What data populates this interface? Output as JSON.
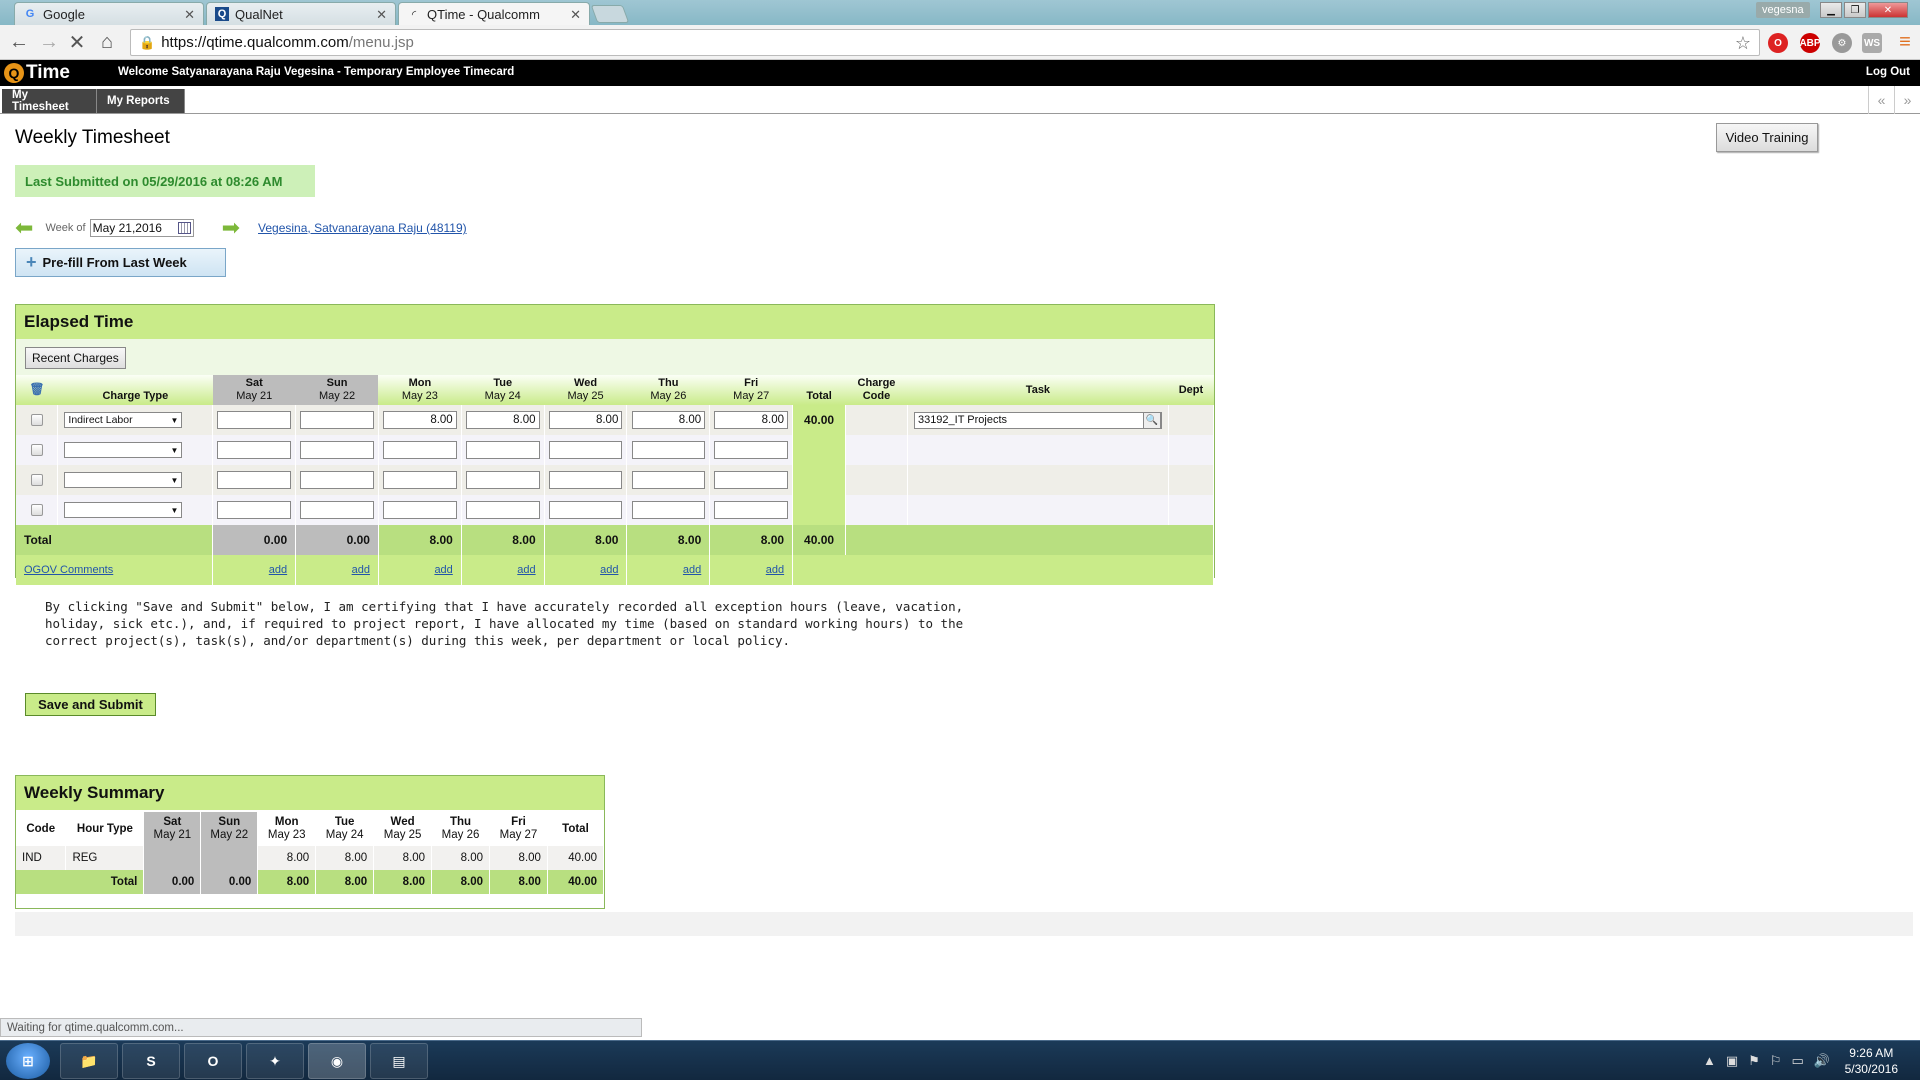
{
  "browser": {
    "tabs": [
      {
        "label": "Google",
        "icon": "G"
      },
      {
        "label": "QualNet",
        "icon": "Q"
      },
      {
        "label": "QTime - Qualcomm",
        "icon": ""
      }
    ],
    "window_user": "vegesna",
    "url_host": "https://qtime.qualcomm.com",
    "url_path": "/menu.jsp",
    "extensions": [
      {
        "name": "opera-icon",
        "color": "#d22"
      },
      {
        "name": "adblock-icon",
        "label": "ABP",
        "color": "#c00"
      },
      {
        "name": "extension-icon",
        "color": "#999"
      },
      {
        "name": "ws-icon",
        "label": "WS",
        "color": "#aaa"
      }
    ]
  },
  "app": {
    "logo_text": "Time",
    "welcome": "Welcome Satyanarayana Raju Vegesina - Temporary Employee Timecard",
    "logout": "Log Out",
    "nav": [
      "My Timesheet",
      "My Reports"
    ]
  },
  "page": {
    "title": "Weekly Timesheet",
    "video_training": "Video Training",
    "last_submitted": "Last Submitted on 05/29/2016 at 08:26 AM",
    "week_of_label": "Week of",
    "week_of_value": "May 21,2016",
    "employee_link": "Vegesina, Satvanarayana Raju (48119)",
    "prefill_label": "Pre-fill From Last Week"
  },
  "elapsed": {
    "title": "Elapsed Time",
    "recent_charges": "Recent Charges",
    "headers": {
      "charge_type": "Charge Type",
      "days": [
        {
          "day": "Sat",
          "date": "May 21"
        },
        {
          "day": "Sun",
          "date": "May 22"
        },
        {
          "day": "Mon",
          "date": "May 23"
        },
        {
          "day": "Tue",
          "date": "May 24"
        },
        {
          "day": "Wed",
          "date": "May 25"
        },
        {
          "day": "Thu",
          "date": "May 26"
        },
        {
          "day": "Fri",
          "date": "May 27"
        }
      ],
      "total": "Total",
      "charge_code": "Charge Code",
      "charge_code_line1": "Charge",
      "charge_code_line2": "Code",
      "task": "Task",
      "dept": "Dept"
    },
    "rows": [
      {
        "charge_type": "Indirect Labor",
        "hours": [
          "",
          "",
          "8.00",
          "8.00",
          "8.00",
          "8.00",
          "8.00"
        ],
        "total": "40.00",
        "task": "33192_IT Projects"
      },
      {
        "charge_type": "",
        "hours": [
          "",
          "",
          "",
          "",
          "",
          "",
          ""
        ],
        "total": "",
        "task": ""
      },
      {
        "charge_type": "",
        "hours": [
          "",
          "",
          "",
          "",
          "",
          "",
          ""
        ],
        "total": "",
        "task": ""
      },
      {
        "charge_type": "",
        "hours": [
          "",
          "",
          "",
          "",
          "",
          "",
          ""
        ],
        "total": "",
        "task": ""
      }
    ],
    "total_label": "Total",
    "day_totals": [
      "0.00",
      "0.00",
      "8.00",
      "8.00",
      "8.00",
      "8.00",
      "8.00"
    ],
    "grand_total": "40.00",
    "comments_link": "OGOV Comments",
    "add_label": "add"
  },
  "certify_text": "By clicking \"Save and Submit\" below, I am certifying that I have accurately recorded all exception hours (leave, vacation, holiday, sick etc.), and, if required to project report, I have allocated my time (based on standard working hours) to the correct project(s), task(s), and/or department(s) during this week, per department or local policy.",
  "save_submit": "Save and Submit",
  "summary": {
    "title": "Weekly Summary",
    "headers": {
      "code": "Code",
      "hour_type": "Hour Type",
      "total": "Total"
    },
    "row": {
      "code": "IND",
      "hour_type": "REG",
      "values": [
        "",
        "",
        "8.00",
        "8.00",
        "8.00",
        "8.00",
        "8.00"
      ],
      "total": "40.00"
    },
    "total_label": "Total",
    "totals": [
      "0.00",
      "0.00",
      "8.00",
      "8.00",
      "8.00",
      "8.00",
      "8.00"
    ],
    "grand_total": "40.00"
  },
  "status_bar": "Waiting for qtime.qualcomm.com...",
  "taskbar": {
    "time": "9:26 AM",
    "date": "5/30/2016"
  }
}
